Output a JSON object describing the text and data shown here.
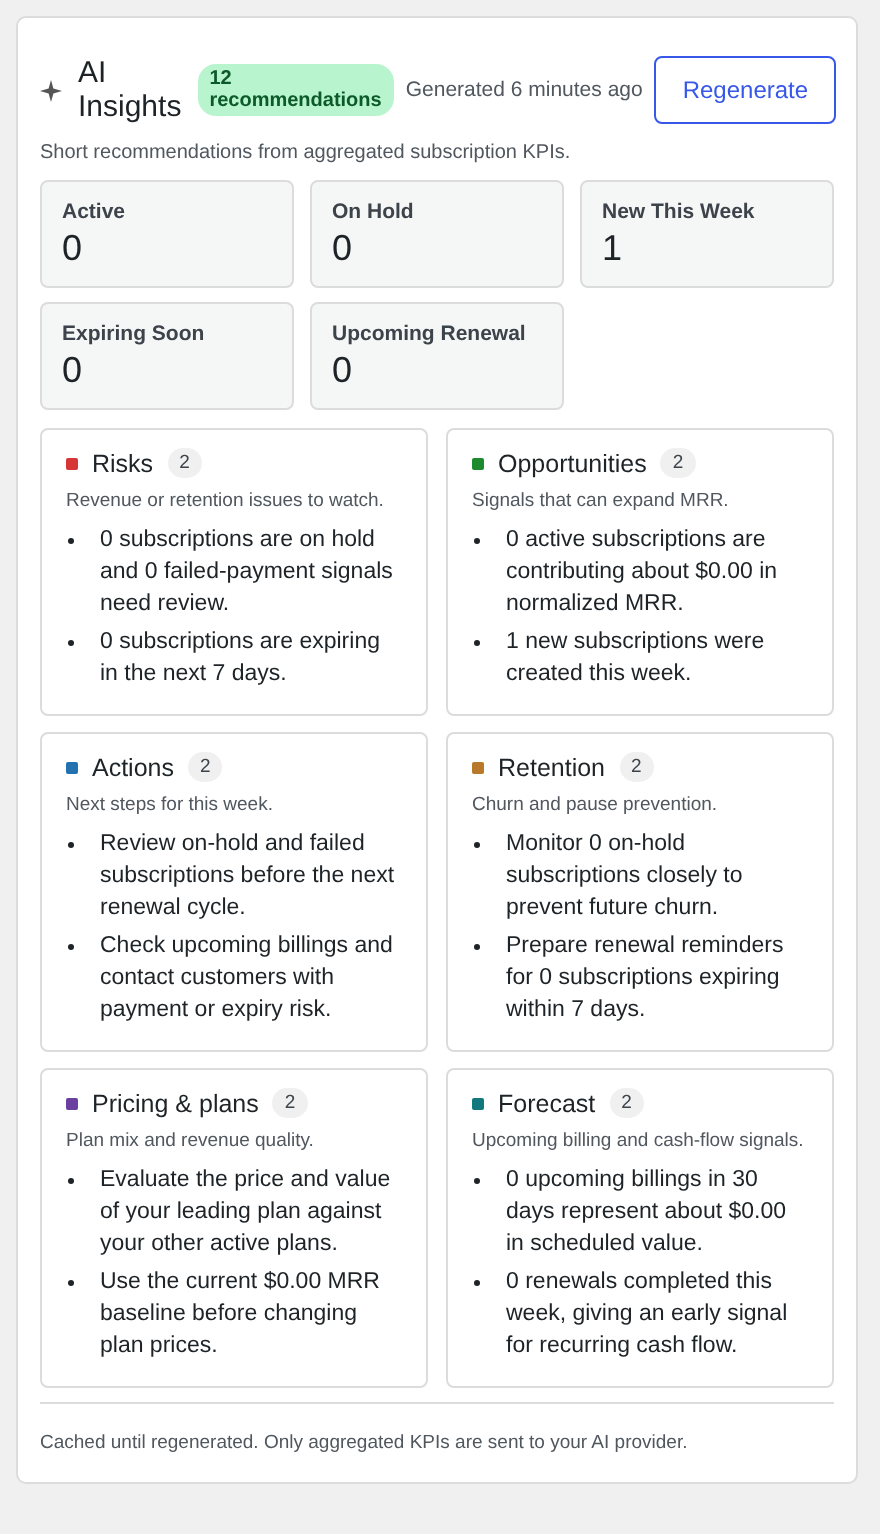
{
  "header": {
    "title": "AI Insights",
    "badge": "12 recommendations",
    "generated": "Generated 6 minutes ago",
    "button": "Regenerate"
  },
  "subtitle": "Short recommendations from aggregated subscription KPIs.",
  "kpis": [
    {
      "label": "Active",
      "value": "0"
    },
    {
      "label": "On Hold",
      "value": "0"
    },
    {
      "label": "New This Week",
      "value": "1"
    },
    {
      "label": "Expiring Soon",
      "value": "0"
    },
    {
      "label": "Upcoming Renewal",
      "value": "0"
    }
  ],
  "sections": [
    {
      "title": "Risks",
      "count": "2",
      "color": "#d63638",
      "description": "Revenue or retention issues to watch.",
      "items": [
        "0 subscriptions are on hold and 0 failed-payment signals need review.",
        "0 subscriptions are expiring in the next 7 days."
      ]
    },
    {
      "title": "Opportunities",
      "count": "2",
      "color": "#1e8a2e",
      "description": "Signals that can expand MRR.",
      "items": [
        "0 active subscriptions are contributing about $0.00 in normalized MRR.",
        "1 new subscriptions were created this week."
      ]
    },
    {
      "title": "Actions",
      "count": "2",
      "color": "#2271b1",
      "description": "Next steps for this week.",
      "items": [
        "Review on-hold and failed subscriptions before the next renewal cycle.",
        "Check upcoming billings and contact customers with payment or expiry risk."
      ]
    },
    {
      "title": "Retention",
      "count": "2",
      "color": "#b8792a",
      "description": "Churn and pause prevention.",
      "items": [
        "Monitor 0 on-hold subscriptions closely to prevent future churn.",
        "Prepare renewal reminders for 0 subscriptions expiring within 7 days."
      ]
    },
    {
      "title": "Pricing & plans",
      "count": "2",
      "color": "#6b3fa0",
      "description": "Plan mix and revenue quality.",
      "items": [
        "Evaluate the price and value of your leading plan against your other active plans.",
        "Use the current $0.00 MRR baseline before changing plan prices."
      ]
    },
    {
      "title": "Forecast",
      "count": "2",
      "color": "#11787e",
      "description": "Upcoming billing and cash-flow signals.",
      "items": [
        "0 upcoming billings in 30 days represent about $0.00 in scheduled value.",
        "0 renewals completed this week, giving an early signal for recurring cash flow."
      ]
    }
  ],
  "footer": "Cached until regenerated. Only aggregated KPIs are sent to your AI provider."
}
